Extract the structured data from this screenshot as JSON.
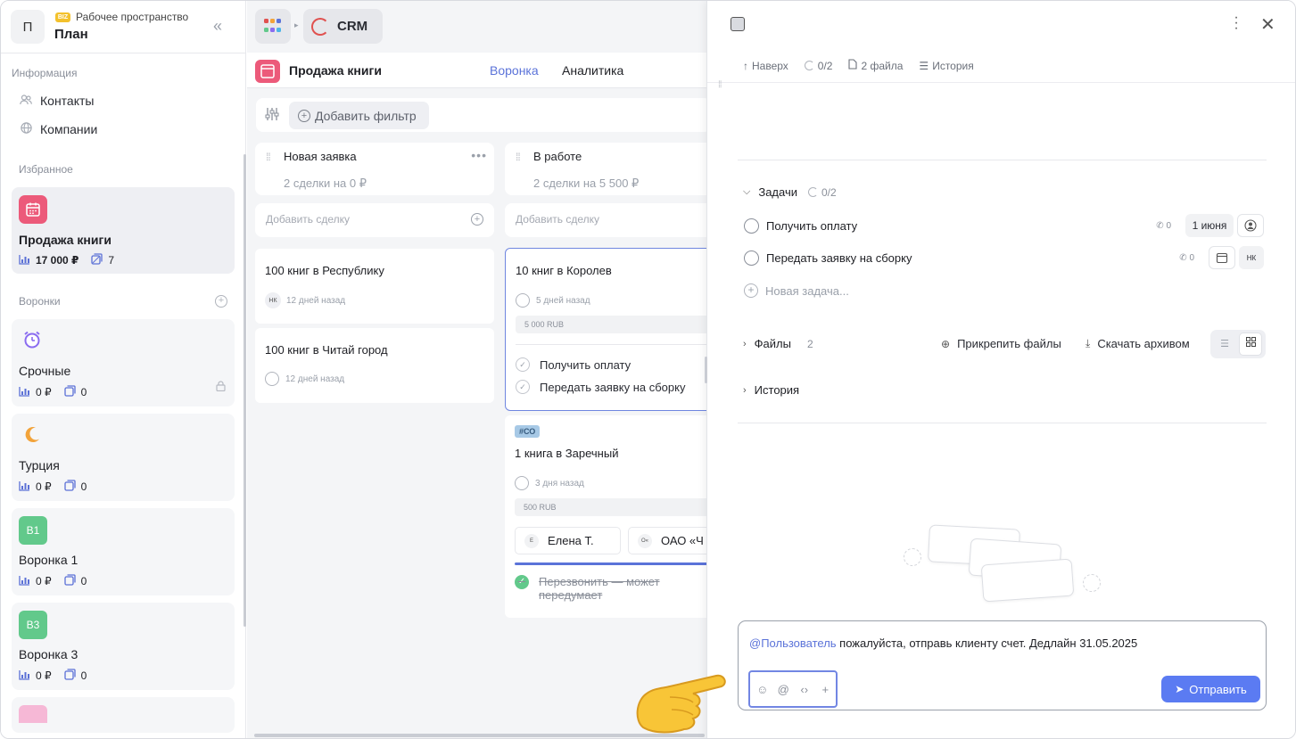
{
  "workspace": {
    "avatar_letter": "П",
    "badge": "BIZ",
    "subtitle": "Рабочее пространство",
    "name": "План"
  },
  "sidebar": {
    "info_label": "Информация",
    "info_items": [
      {
        "label": "Контакты",
        "icon": "users-icon"
      },
      {
        "label": "Компании",
        "icon": "globe-icon"
      }
    ],
    "favorites_label": "Избранное",
    "favorite": {
      "title": "Продажа книги",
      "amount": "17 000 ₽",
      "count": "7"
    },
    "funnels_label": "Воронки",
    "funnels": [
      {
        "name": "Срочные",
        "icon": "alarm-clock-icon",
        "amount": "0 ₽",
        "count": "0",
        "locked": true
      },
      {
        "name": "Турция",
        "icon": "crescent-moon-icon",
        "amount": "0 ₽",
        "count": "0"
      },
      {
        "name": "Воронка 1",
        "badge": "В1",
        "amount": "0 ₽",
        "count": "0"
      },
      {
        "name": "Воронка 3",
        "badge": "В3",
        "amount": "0 ₽",
        "count": "0"
      }
    ]
  },
  "topbar": {
    "app_title": "CRM"
  },
  "pipeline": {
    "title": "Продажа книги",
    "tabs": [
      "Воронка",
      "Аналитика"
    ],
    "active_tab": "Воронка",
    "add_filter": "Добавить фильтр"
  },
  "columns": [
    {
      "name": "Новая заявка",
      "summary_prefix": "2 сделки на",
      "summary_value": "0 ₽",
      "add_deal": "Добавить сделку",
      "deals": [
        {
          "title": "100 книг в Республику",
          "avatar": "НК",
          "time": "12 дней назад"
        },
        {
          "title": "100 книг в Читай город",
          "time": "12 дней назад"
        }
      ]
    },
    {
      "name": "В работе",
      "summary_prefix": "2 сделки на",
      "summary_value": "5 500 ₽",
      "add_deal": "Добавить сделку",
      "deals": [
        {
          "title": "10 книг в Королев",
          "time": "5 дней назад",
          "price": "5 000 RUB",
          "tasks": [
            "Получить оплату",
            "Передать заявку на сборку"
          ]
        },
        {
          "tag": "#СО",
          "title": "1 книга в Заречный",
          "time": "3 дня назад",
          "price": "500 RUB",
          "contacts": [
            {
              "initial": "Е",
              "name": "Елена Т."
            },
            {
              "initial": "О«",
              "name": "ОАО «Ч"
            }
          ],
          "done_task": "Перезвонить — может передумает"
        }
      ]
    }
  ],
  "panel": {
    "up_label": "Наверх",
    "progress": "0/2",
    "files_count_label": "2 файла",
    "history_label": "История",
    "tasks_section": {
      "title": "Задачи",
      "progress": "0/2"
    },
    "tasks": [
      {
        "label": "Получить оплату",
        "calls": "0",
        "date": "1 июня"
      },
      {
        "label": "Передать заявку на сборку",
        "calls": "0",
        "assignee": "НК"
      }
    ],
    "new_task_placeholder": "Новая задача...",
    "files_section": {
      "title": "Файлы",
      "count": "2",
      "attach": "Прикрепить файлы",
      "download": "Скачать архивом"
    },
    "history_section": {
      "title": "История"
    },
    "comment": {
      "mention": "@Пользователь",
      "text": " пожалуйста, отправь клиенту счет. Дедлайн 31.05.2025",
      "send_label": "Отправить"
    }
  },
  "colors": {
    "accent": "#5b73d9",
    "send": "#5b7bf2",
    "pink": "#ec5a7a",
    "green": "#62c98b"
  }
}
